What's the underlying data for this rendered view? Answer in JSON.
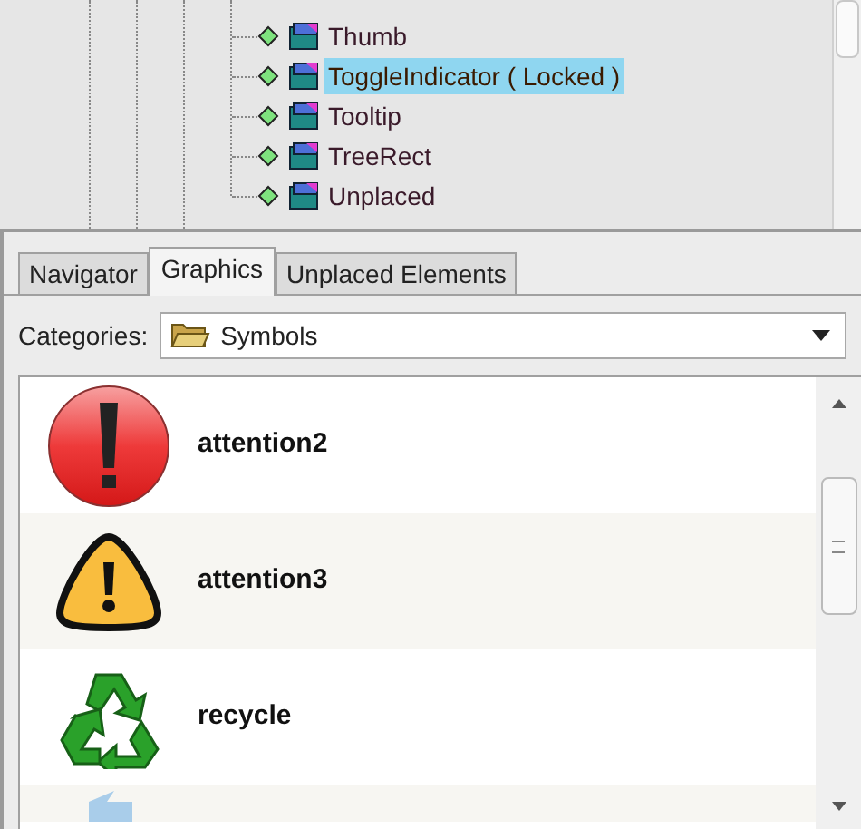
{
  "tree": {
    "items": [
      {
        "label": "Thumb",
        "selected": false
      },
      {
        "label": "ToggleIndicator ( Locked )",
        "selected": true
      },
      {
        "label": "Tooltip",
        "selected": false
      },
      {
        "label": "TreeRect",
        "selected": false
      },
      {
        "label": "Unplaced",
        "selected": false
      }
    ]
  },
  "tabs": [
    {
      "label": "Navigator",
      "selected": false
    },
    {
      "label": "Graphics",
      "selected": true
    },
    {
      "label": "Unplaced Elements",
      "selected": false
    }
  ],
  "categories": {
    "label": "Categories:",
    "value": "Symbols"
  },
  "symbols": [
    {
      "kind": "error",
      "label": "attention2"
    },
    {
      "kind": "warning",
      "label": "attention3"
    },
    {
      "kind": "recycle",
      "label": "recycle"
    },
    {
      "kind": "arrow"
    }
  ]
}
